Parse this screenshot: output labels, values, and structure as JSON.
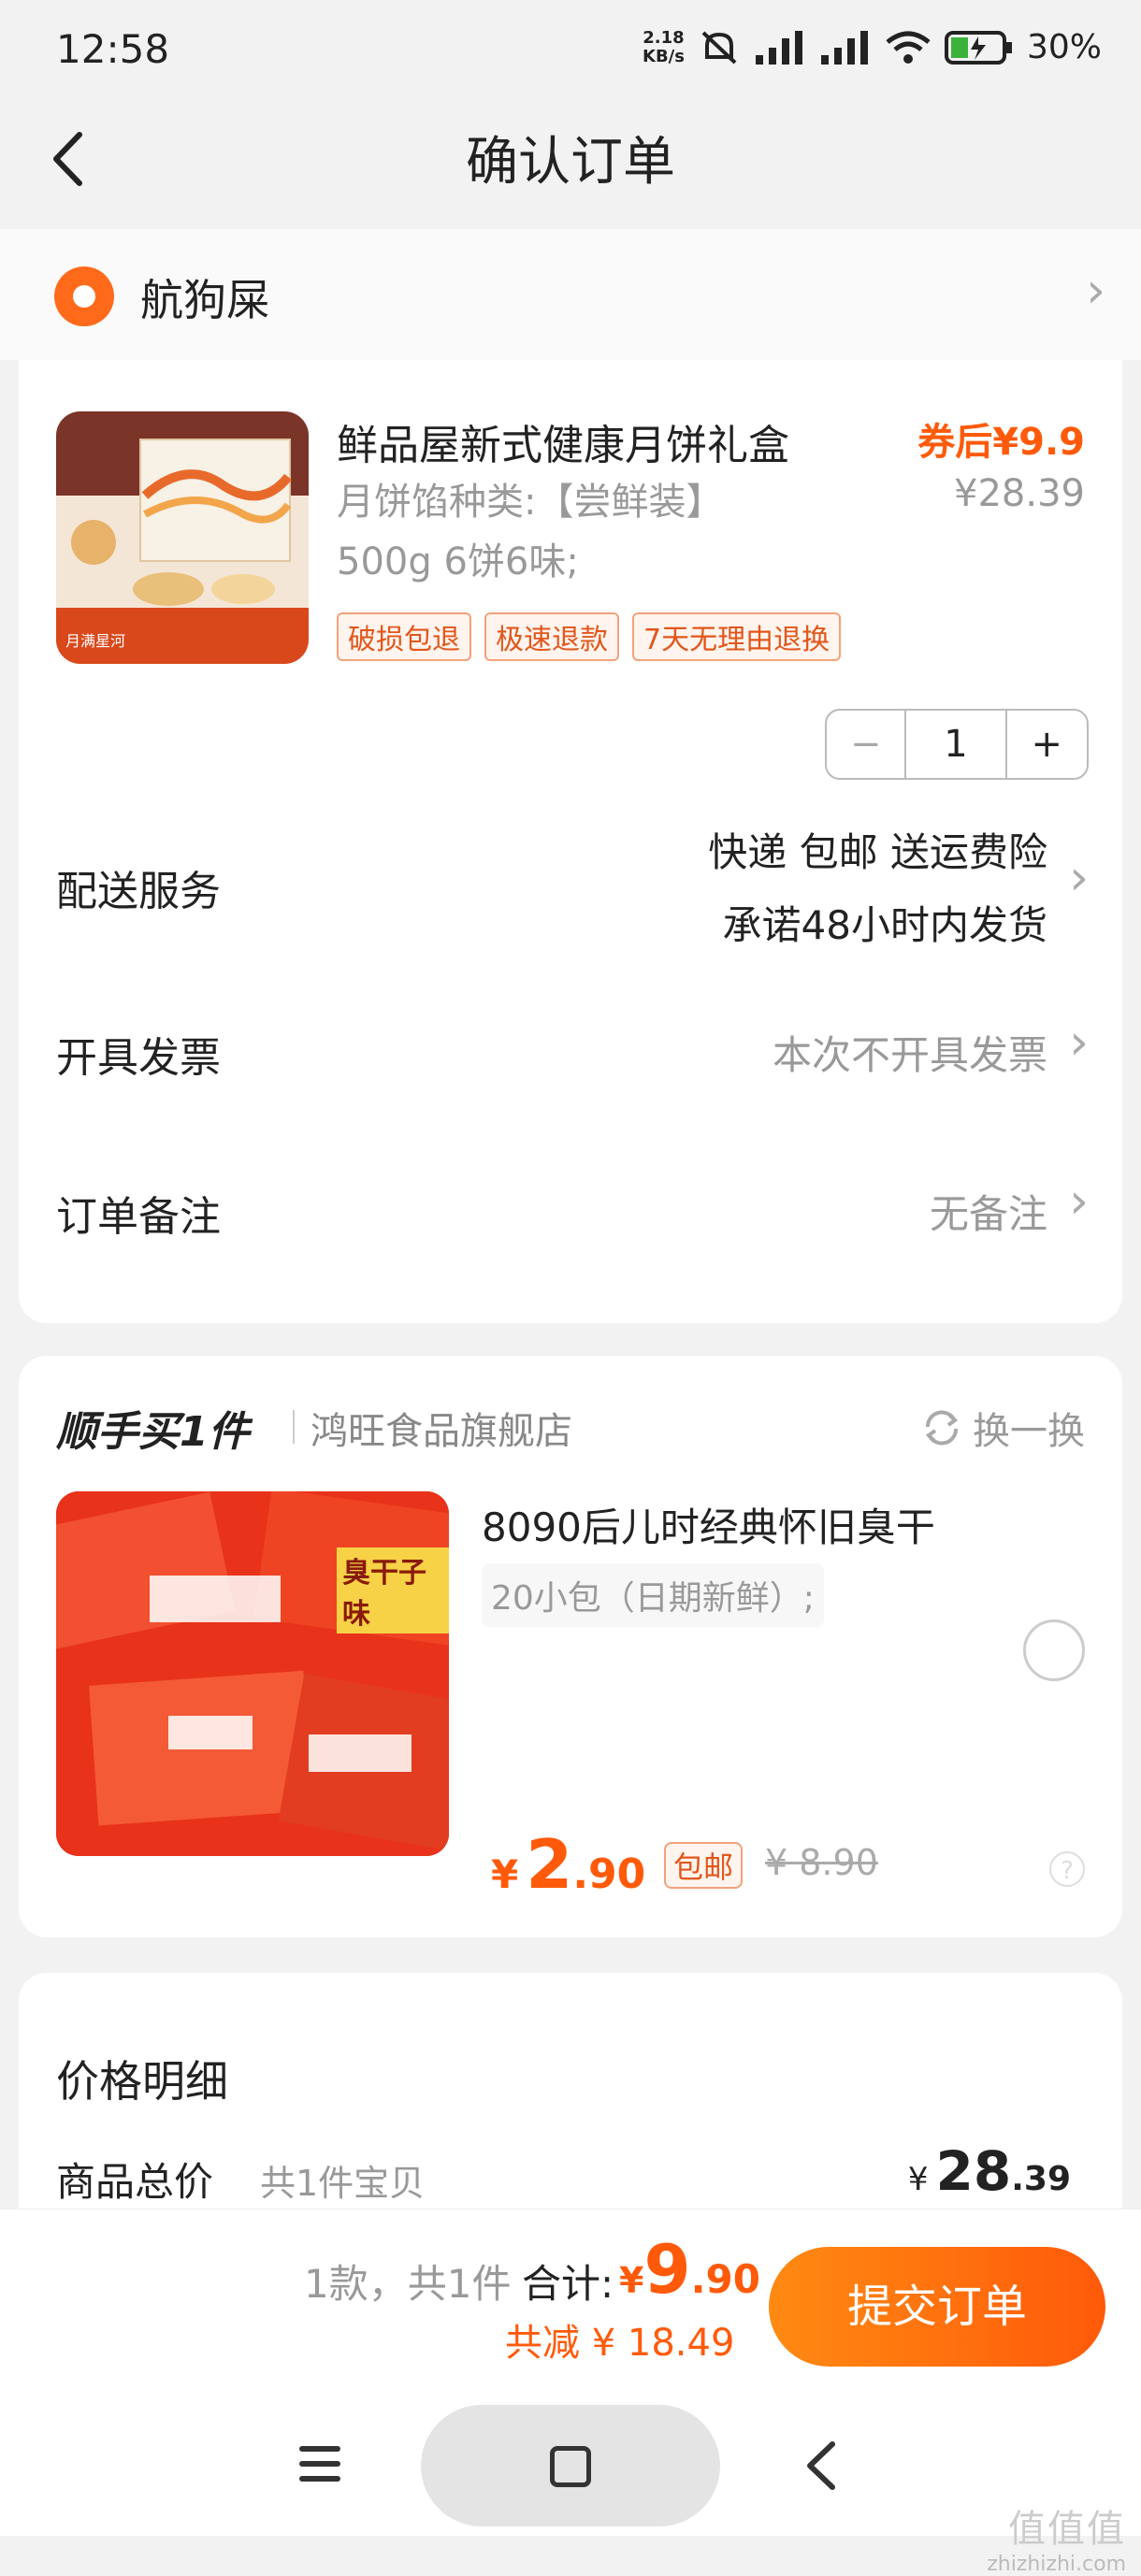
{
  "status_bar": {
    "time": "12:58",
    "speed_value": "2.18",
    "speed_unit": "KB/s",
    "battery": "30%"
  },
  "header": {
    "title": "确认订单"
  },
  "address": {
    "name": "航狗屎"
  },
  "order_item": {
    "title": "鲜品屋新式健康月饼礼盒",
    "spec_line1": "月饼馅种类:【尝鲜装】",
    "spec_line2": "500g 6饼6味;",
    "tags": [
      "破损包退",
      "极速退款",
      "7天无理由退换"
    ],
    "price_after_coupon": "券后¥9.9",
    "original_price": "¥28.39",
    "quantity": "1",
    "minus": "−",
    "plus": "+",
    "image_caption": "月满星河"
  },
  "delivery": {
    "label": "配送服务",
    "value_line1": "快递 包邮 送运费险",
    "value_line2": "承诺48小时内发货"
  },
  "invoice": {
    "label": "开具发票",
    "value": "本次不开具发票"
  },
  "remark": {
    "label": "订单备注",
    "value": "无备注"
  },
  "addon": {
    "title": "顺手买1件",
    "store": "鸿旺食品旗舰店",
    "swap": "换一换",
    "product_title": "8090后儿时经典怀旧臭干",
    "product_spec": "20小包（日期新鲜）;",
    "price_currency": "¥",
    "price_int": "2",
    "price_dec": ".90",
    "free_shipping_tag": "包邮",
    "original_price": "¥ 8.90",
    "help": "?",
    "image_label": "臭干子味"
  },
  "price_detail": {
    "title": "价格明细",
    "goods_total_label": "商品总价",
    "goods_count": "共1件宝贝",
    "currency": "¥",
    "price_int": "28",
    "price_dec": ".39"
  },
  "bottom_bar": {
    "count": "1款，共1件",
    "total_label": "合计:",
    "total_currency": "¥",
    "total_int": "9",
    "total_dec": ".90",
    "saving": "共减 ¥ 18.49",
    "submit": "提交订单"
  },
  "watermark": {
    "big": "值值值",
    "small": "zhizhizhi.com"
  },
  "colors": {
    "accent": "#ff5a0a",
    "background": "#f2f2f2"
  }
}
